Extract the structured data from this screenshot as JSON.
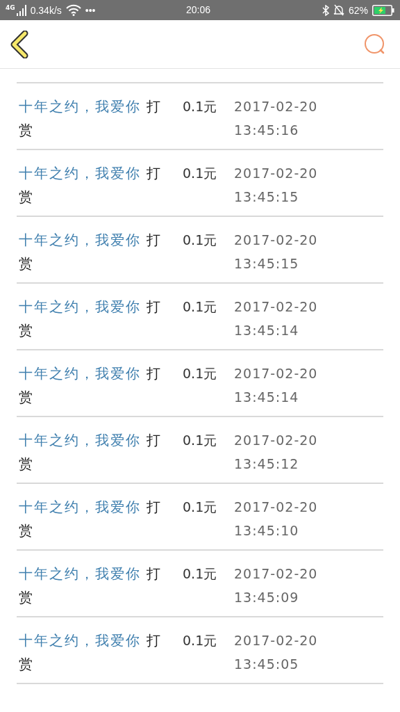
{
  "status_bar": {
    "network": "4G",
    "speed": "0.34k/s",
    "more": "•••",
    "time": "20:06",
    "battery_text": "62%"
  },
  "records": [
    {
      "book": "十年之约，我爱你",
      "type": "打赏",
      "amount": "0.1元",
      "time": "2017-02-20 13:45:16"
    },
    {
      "book": "十年之约，我爱你",
      "type": "打赏",
      "amount": "0.1元",
      "time": "2017-02-20 13:45:15"
    },
    {
      "book": "十年之约，我爱你",
      "type": "打赏",
      "amount": "0.1元",
      "time": "2017-02-20 13:45:15"
    },
    {
      "book": "十年之约，我爱你",
      "type": "打赏",
      "amount": "0.1元",
      "time": "2017-02-20 13:45:14"
    },
    {
      "book": "十年之约，我爱你",
      "type": "打赏",
      "amount": "0.1元",
      "time": "2017-02-20 13:45:14"
    },
    {
      "book": "十年之约，我爱你",
      "type": "打赏",
      "amount": "0.1元",
      "time": "2017-02-20 13:45:12"
    },
    {
      "book": "十年之约，我爱你",
      "type": "打赏",
      "amount": "0.1元",
      "time": "2017-02-20 13:45:10"
    },
    {
      "book": "十年之约，我爱你",
      "type": "打赏",
      "amount": "0.1元",
      "time": "2017-02-20 13:45:09"
    },
    {
      "book": "十年之约，我爱你",
      "type": "打赏",
      "amount": "0.1元",
      "time": "2017-02-20 13:45:05"
    }
  ]
}
